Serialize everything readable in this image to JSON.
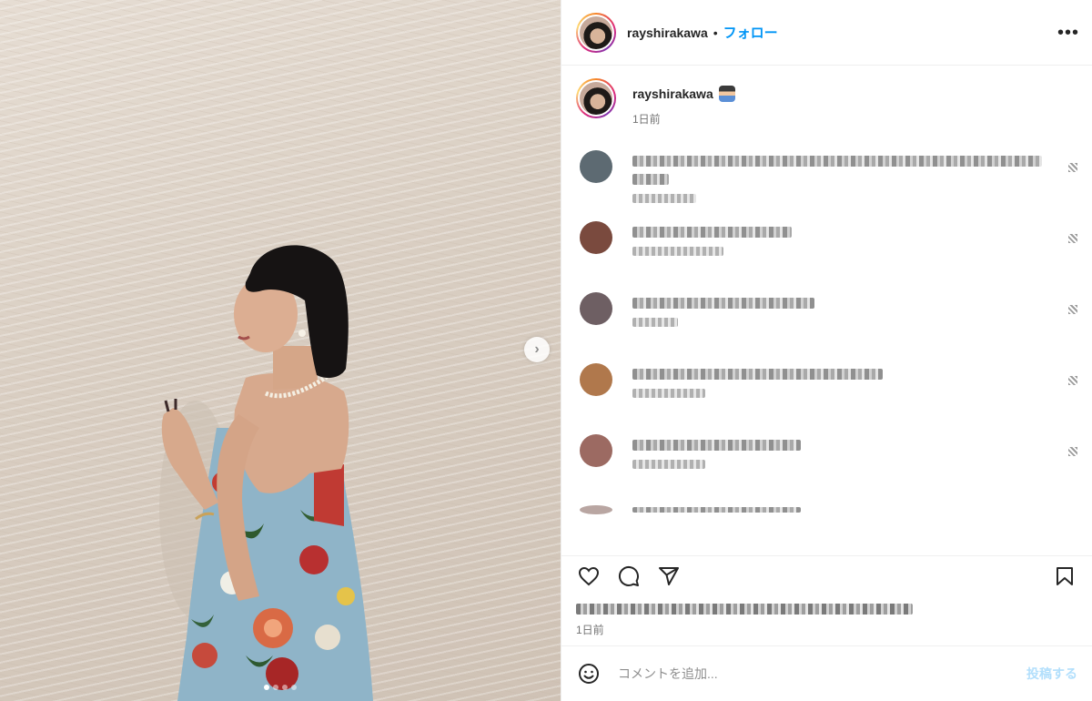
{
  "header": {
    "username": "rayshirakawa",
    "separator": "•",
    "follow_label": "フォロー",
    "more_icon": "more-horizontal-icon",
    "more_label": "•••"
  },
  "caption": {
    "username": "rayshirakawa",
    "emoji_icon": "person-emoji-icon",
    "time": "1日前"
  },
  "carousel": {
    "next_icon": "chevron-right-icon",
    "next_label": "›",
    "slide_count": 4,
    "active_slide": 1
  },
  "comments": [
    {
      "avatar_color": "#5d6a72",
      "lines": 2,
      "blurred": true
    },
    {
      "avatar_color": "#7a4a3e",
      "lines": 1,
      "blurred": true
    },
    {
      "avatar_color": "#6e5f63",
      "lines": 1,
      "blurred": true
    },
    {
      "avatar_color": "#b0784c",
      "lines": 1,
      "blurred": true
    },
    {
      "avatar_color": "#9c6a62",
      "lines": 1,
      "blurred": true
    }
  ],
  "actions": {
    "like_icon": "heart-icon",
    "comment_icon": "comment-icon",
    "share_icon": "share-icon",
    "save_icon": "bookmark-icon"
  },
  "footer": {
    "post_time": "1日前"
  },
  "add_comment": {
    "emoji_icon": "smiley-icon",
    "placeholder": "コメントを追加...",
    "post_label": "投稿する"
  },
  "colors": {
    "link_blue": "#0095f6",
    "post_disabled": "#b2dffc",
    "text": "#262626",
    "muted": "#737373"
  }
}
